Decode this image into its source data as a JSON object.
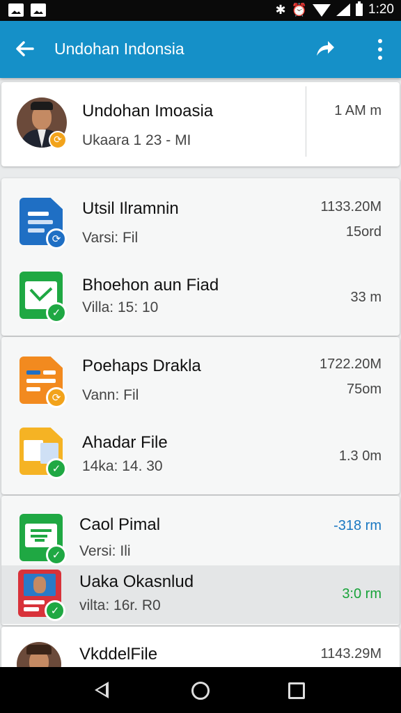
{
  "status_bar": {
    "time": "1:20",
    "icons": [
      "gallery-icon",
      "app-icon",
      "bluetooth-icon",
      "alarm-icon",
      "wifi-icon",
      "signal-icon",
      "battery-icon"
    ]
  },
  "app_bar": {
    "title": "Undohan Indonsia",
    "icons": [
      "back-arrow-icon",
      "share-icon",
      "more-vert-icon"
    ]
  },
  "header": {
    "name": "Undohan Imoasia",
    "subtitle": "Ukaara 1 23 - MI",
    "meta": "1 AM m"
  },
  "groups": [
    {
      "items": [
        {
          "title": "Utsil Ilramnin",
          "subtitle": "Varsi: Fil",
          "meta1": "1133.20M",
          "meta2": "15ord",
          "icon": "document-icon",
          "color": "#1f6fc4",
          "badge": "sync"
        },
        {
          "title": "Bhoehon aun Fiad",
          "subtitle": "Villa: 15: 10",
          "meta1": "",
          "meta2": "33 m",
          "icon": "sheet-icon",
          "color": "#1fa843",
          "badge": "check"
        }
      ]
    },
    {
      "items": [
        {
          "title": "Poehaps Drakla",
          "subtitle": "Vann: Fil",
          "meta1": "1722.20M",
          "meta2": "75om",
          "icon": "slides-icon",
          "color": "#f28a1f",
          "badge": "sync"
        },
        {
          "title": "Ahadar File",
          "subtitle": "14ka: 14. 30",
          "meta1": "",
          "meta2": "1.3 0m",
          "icon": "folder-icon",
          "color": "#f5b324",
          "badge": "check"
        }
      ]
    },
    {
      "items": [
        {
          "title": "Caol Pimal",
          "subtitle": "Versi: Ili",
          "meta1": "",
          "meta2": "-318 rm",
          "icon": "sheet-icon",
          "color": "#1fa843",
          "badge": "check"
        },
        {
          "title": "Uaka Okasnlud",
          "subtitle": "vilta: 16r. R0",
          "meta1": "",
          "meta2": "3:0 rm",
          "icon": "image-doc-icon",
          "color": "#d8323a",
          "badge": "check"
        }
      ]
    }
  ],
  "last_item": {
    "title": "VkddelFile",
    "meta": "1143.29M"
  },
  "colors": {
    "app_bar": "#1590c8",
    "meta_blue": "#1a78c2",
    "meta_green": "#18a33a",
    "badge_blue": "#1f6fc4",
    "badge_green": "#1fa843",
    "badge_orange": "#f2a31b"
  },
  "nav_bar": {
    "icons": [
      "nav-back-icon",
      "nav-home-icon",
      "nav-recents-icon"
    ]
  }
}
